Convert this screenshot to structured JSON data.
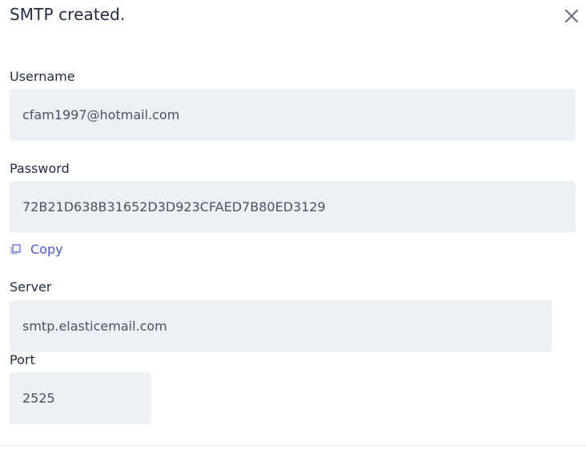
{
  "dialog": {
    "title": "SMTP created.",
    "close_icon": "close-icon"
  },
  "fields": {
    "username": {
      "label": "Username",
      "value": "cfam1997@hotmail.com"
    },
    "password": {
      "label": "Password",
      "value": "72B21D638B31652D3D923CFAED7B80ED3129"
    },
    "server": {
      "label": "Server",
      "value": "smtp.elasticemail.com"
    },
    "port": {
      "label": "Port",
      "value": "2525"
    }
  },
  "copy": {
    "label": "Copy",
    "icon": "copy-icon"
  },
  "colors": {
    "field_bg": "#edf1f6",
    "link": "#4a5bd0",
    "text": "#1f2a44"
  }
}
